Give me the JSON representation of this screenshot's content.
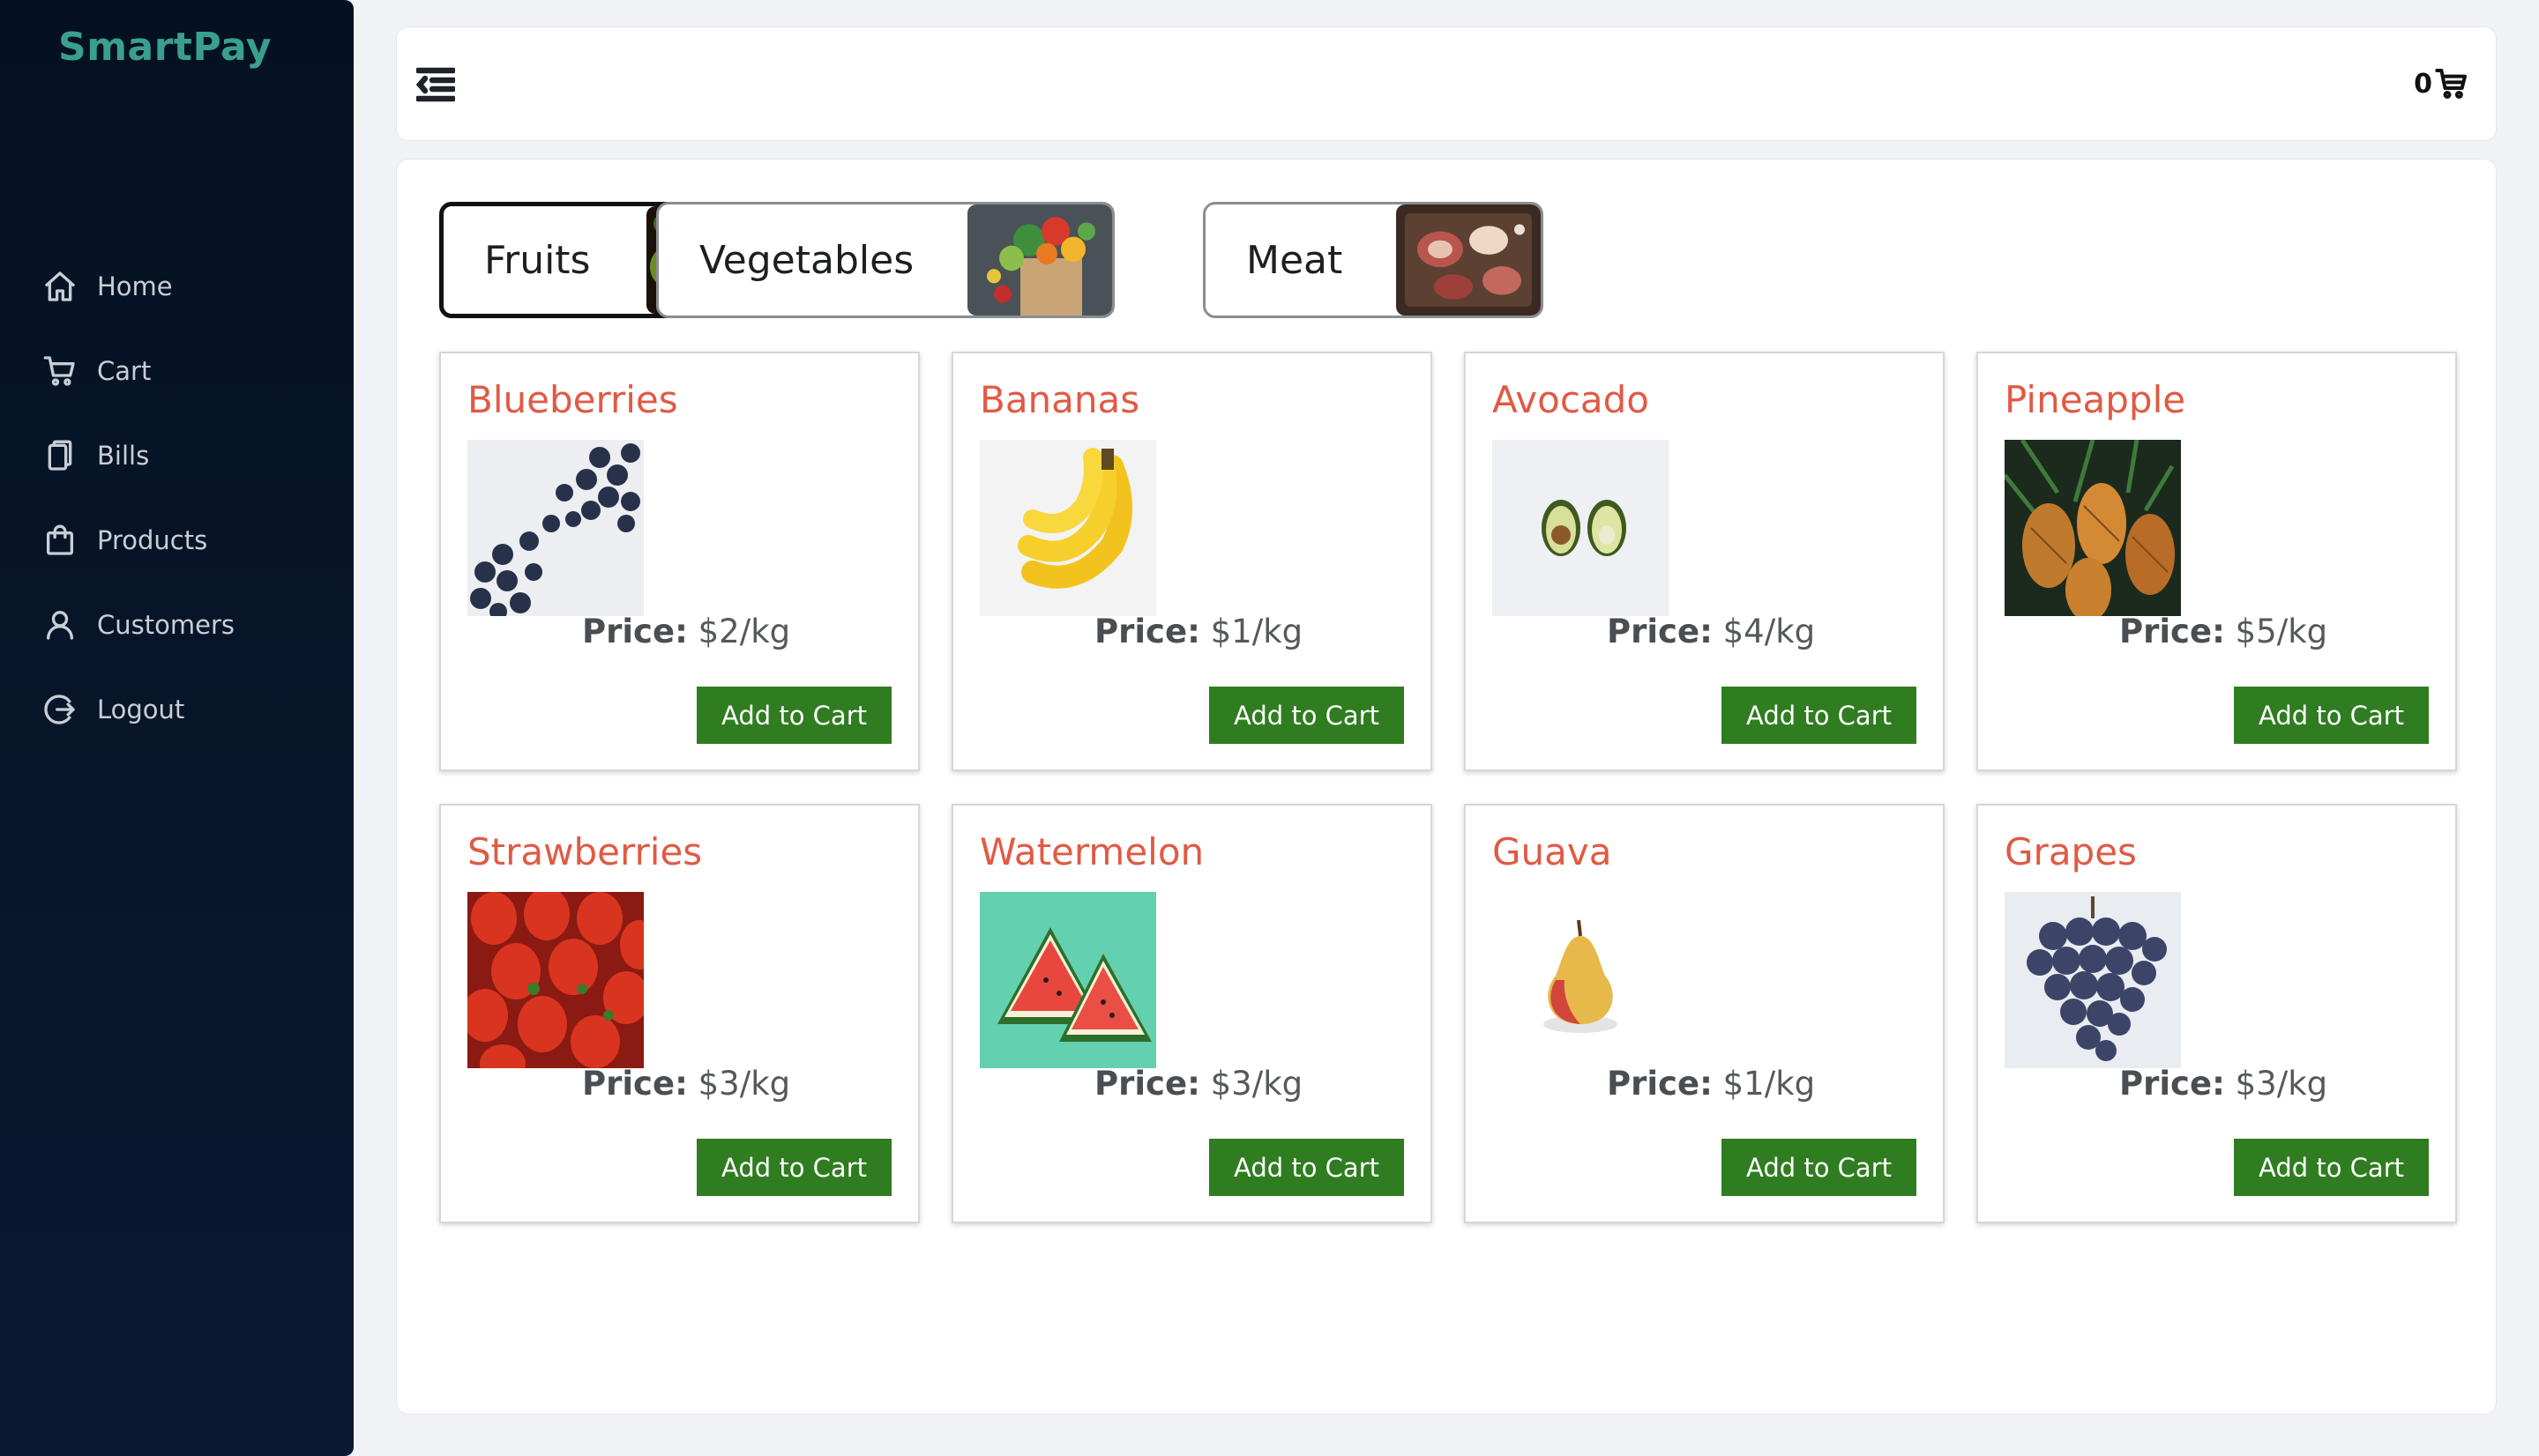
{
  "app": {
    "brand": "SmartPay"
  },
  "sidebar": {
    "items": [
      {
        "label": "Home",
        "icon": "home-icon"
      },
      {
        "label": "Cart",
        "icon": "cart-icon"
      },
      {
        "label": "Bills",
        "icon": "bills-icon"
      },
      {
        "label": "Products",
        "icon": "bag-icon"
      },
      {
        "label": "Customers",
        "icon": "user-icon"
      },
      {
        "label": "Logout",
        "icon": "logout-icon"
      }
    ]
  },
  "topbar": {
    "cart_count": "0"
  },
  "categories": [
    {
      "label": "Fruits",
      "active": true
    },
    {
      "label": "Vegetables",
      "active": false
    },
    {
      "label": "Meat",
      "active": false
    }
  ],
  "price_label": "Price:",
  "add_label": "Add to Cart",
  "products": [
    {
      "name": "Blueberries",
      "price": "$2/kg"
    },
    {
      "name": "Bananas",
      "price": "$1/kg"
    },
    {
      "name": "Avocado",
      "price": "$4/kg"
    },
    {
      "name": "Pineapple",
      "price": "$5/kg"
    },
    {
      "name": "Strawberries",
      "price": "$3/kg"
    },
    {
      "name": "Watermelon",
      "price": "$3/kg"
    },
    {
      "name": "Guava",
      "price": "$1/kg"
    },
    {
      "name": "Grapes",
      "price": "$3/kg"
    }
  ],
  "colors": {
    "sidebar_bg": "#07162b",
    "brand": "#3a9f8f",
    "product_name": "#e05a44",
    "button": "#2f7d20"
  }
}
